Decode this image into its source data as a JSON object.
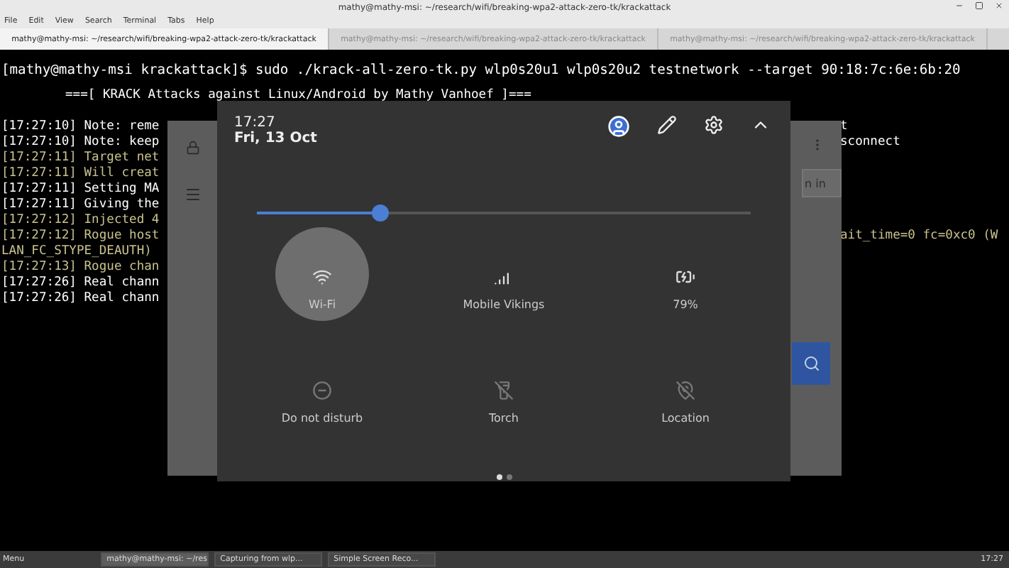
{
  "window": {
    "title": "mathy@mathy-msi: ~/research/wifi/breaking-wpa2-attack-zero-tk/krackattack"
  },
  "menu": [
    "File",
    "Edit",
    "View",
    "Search",
    "Terminal",
    "Tabs",
    "Help"
  ],
  "tabs": [
    {
      "label": "mathy@mathy-msi: ~/research/wifi/breaking-wpa2-attack-zero-tk/krackattack",
      "selected": true
    },
    {
      "label": "mathy@mathy-msi: ~/research/wifi/breaking-wpa2-attack-zero-tk/krackattack",
      "selected": false
    },
    {
      "label": "mathy@mathy-msi: ~/research/wifi/breaking-wpa2-attack-zero-tk/krackattack",
      "selected": false
    }
  ],
  "terminal": {
    "command": "[mathy@mathy-msi krackattack]$ sudo ./krack-all-zero-tk.py wlp0s20u1 wlp0s20u2 testnetwork --target 90:18:7c:6e:6b:20",
    "banner": "===[ KRACK Attacks against Linux/Android by Mathy Vanhoef ]===",
    "lines": [
      {
        "left": "[17:27:10] Note: reme",
        "right": "t",
        "color": "#ffffff"
      },
      {
        "left": "[17:27:10] Note: keep",
        "right": "sconnect",
        "color": "#ffffff"
      },
      {
        "left": "[17:27:11] Target net",
        "color": "#c9c28e"
      },
      {
        "left": "[17:27:11] Will creat",
        "color": "#c9c28e"
      },
      {
        "left": "[17:27:11] Setting MA",
        "color": "#ffffff"
      },
      {
        "left": "[17:27:11] Giving the",
        "color": "#ffffff"
      },
      {
        "left": "[17:27:12] Injected 4",
        "color": "#c9c28e"
      },
      {
        "left": "[17:27:12] Rogue host",
        "right": "ait_time=0 fc=0xc0 (W",
        "color": "#c9c28e"
      },
      {
        "left": "LAN_FC_STYPE_DEAUTH)",
        "color": "#c9c28e"
      },
      {
        "left": "[17:27:13] Rogue chan",
        "color": "#c9c28e"
      },
      {
        "left": "[17:27:26] Real chann",
        "color": "#ffffff"
      },
      {
        "left": "[17:27:26] Real chann",
        "color": "#ffffff"
      }
    ]
  },
  "phone": {
    "sign_in": "n in",
    "quick_settings": {
      "time": "17:27",
      "date": "Fri, 13 Oct",
      "brightness": {
        "level": 0.25
      },
      "tiles": [
        {
          "kind": "wifi",
          "label": "Wi-Fi",
          "highlighted": true
        },
        {
          "kind": "cell",
          "label": "Mobile Vikings",
          "highlighted": false
        },
        {
          "kind": "battery",
          "label": "79%",
          "highlighted": false
        },
        {
          "kind": "dnd",
          "label": "Do not disturb",
          "highlighted": false
        },
        {
          "kind": "torch",
          "label": "Torch",
          "highlighted": false
        },
        {
          "kind": "location",
          "label": "Location",
          "highlighted": false
        }
      ],
      "pages": [
        {
          "selected": true
        },
        {
          "selected": false
        }
      ]
    }
  },
  "taskbar": {
    "menu": "Menu",
    "tasks": [
      {
        "label": "mathy@mathy-msi: ~/res",
        "selected": true
      },
      {
        "label": "Capturing from wlp...",
        "selected": false
      },
      {
        "label": "Simple Screen Reco...",
        "selected": false
      }
    ],
    "clock": "17:27"
  }
}
